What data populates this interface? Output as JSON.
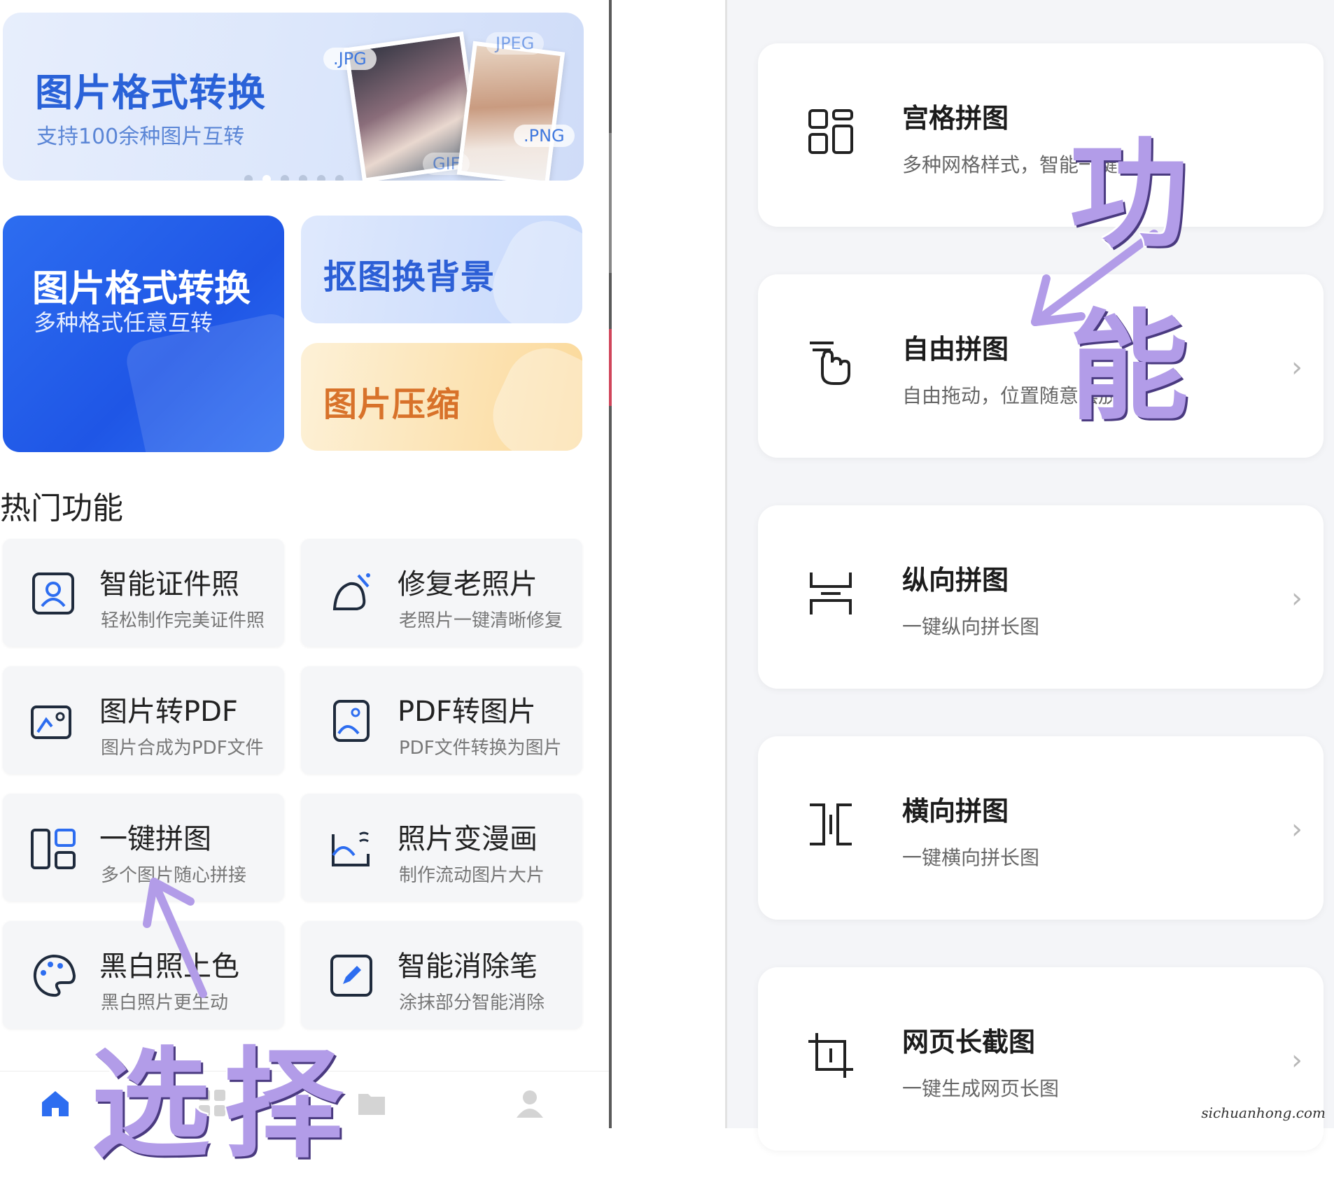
{
  "banner": {
    "title": "图片格式转换",
    "subtitle": "支持100余种图片互转",
    "tags": {
      "jpg": ".JPG",
      "jpeg": "JPEG",
      "png": ".PNG",
      "gif": "GIF"
    },
    "page_count": 6,
    "active_page": 2
  },
  "quick_cards": {
    "format_title": "图片格式转换",
    "format_subtitle": "多种格式任意互转",
    "cutout_title": "抠图换背景",
    "compress_title": "图片压缩"
  },
  "section_title": "热门功能",
  "features": [
    {
      "title": "智能证件照",
      "subtitle": "轻松制作完美证件照",
      "icon": "id-photo-icon"
    },
    {
      "title": "修复老照片",
      "subtitle": "老照片一键清晰修复",
      "icon": "magic-bell-icon"
    },
    {
      "title": "图片转PDF",
      "subtitle": "图片合成为PDF文件",
      "icon": "image-to-pdf-icon"
    },
    {
      "title": "PDF转图片",
      "subtitle": "PDF文件转换为图片",
      "icon": "pdf-to-image-icon"
    },
    {
      "title": "一键拼图",
      "subtitle": "多个图片随心拼接",
      "icon": "collage-icon"
    },
    {
      "title": "照片变漫画",
      "subtitle": "制作流动图片大片",
      "icon": "anime-icon"
    },
    {
      "title": "黑白照上色",
      "subtitle": "黑白照片更生动",
      "icon": "palette-icon"
    },
    {
      "title": "智能消除笔",
      "subtitle": "涂抹部分智能消除",
      "icon": "eraser-pen-icon"
    }
  ],
  "bottom_nav": [
    {
      "name": "home",
      "icon": "home-icon",
      "active": true
    },
    {
      "name": "tools",
      "icon": "grid-icon",
      "active": false
    },
    {
      "name": "files",
      "icon": "folder-icon",
      "active": false
    },
    {
      "name": "profile",
      "icon": "user-icon",
      "active": false
    }
  ],
  "collage_options": [
    {
      "title": "宫格拼图",
      "subtitle": "多种网格样式，智能一键",
      "icon": "grid-collage-icon",
      "chevron": false
    },
    {
      "title": "自由拼图",
      "subtitle": "自由拖动，位置随意摆放",
      "icon": "hand-drag-icon",
      "chevron": true
    },
    {
      "title": "纵向拼图",
      "subtitle": "一键纵向拼长图",
      "icon": "vertical-stitch-icon",
      "chevron": true
    },
    {
      "title": "横向拼图",
      "subtitle": "一键横向拼长图",
      "icon": "horizontal-stitch-icon",
      "chevron": true
    },
    {
      "title": "网页长截图",
      "subtitle": "一键生成网页长图",
      "icon": "crop-icon",
      "chevron": true
    }
  ],
  "annotations": {
    "left": "选择",
    "right": "功能"
  },
  "watermark": "sichuanhong.com",
  "colors": {
    "accent": "#2d6df0",
    "annotation": "#b29ce8",
    "compress": "#d8722a"
  }
}
